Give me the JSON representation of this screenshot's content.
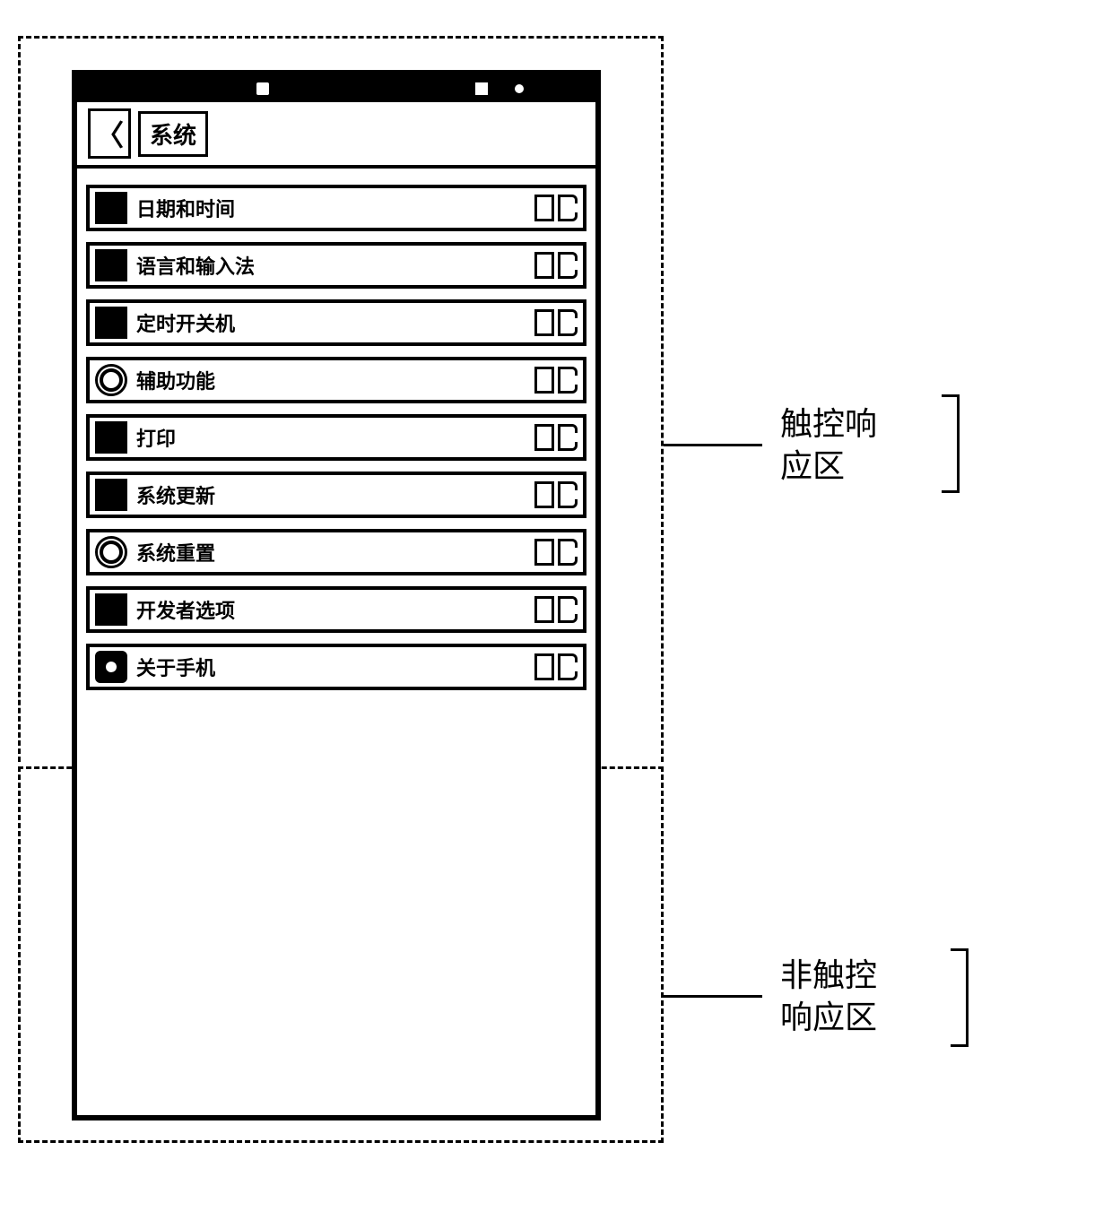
{
  "header": {
    "title": "系统",
    "back_glyph": "〈"
  },
  "menu_items": [
    {
      "label": "日期和时间",
      "icon": "square-dark"
    },
    {
      "label": "语言和输入法",
      "icon": "square-dark"
    },
    {
      "label": "定时开关机",
      "icon": "square-dark"
    },
    {
      "label": "辅助功能",
      "icon": "circle-outline"
    },
    {
      "label": "打印",
      "icon": "square-dark"
    },
    {
      "label": "系统更新",
      "icon": "square-dark"
    },
    {
      "label": "系统重置",
      "icon": "circle-outline"
    },
    {
      "label": "开发者选项",
      "icon": "square-dark"
    },
    {
      "label": "关于手机",
      "icon": "circle-dot"
    }
  ],
  "annotations": {
    "touch_zone_label_line1": "触控响",
    "touch_zone_label_line2": "应区",
    "nontouch_zone_label_line1": "非触控",
    "nontouch_zone_label_line2": "响应区"
  }
}
